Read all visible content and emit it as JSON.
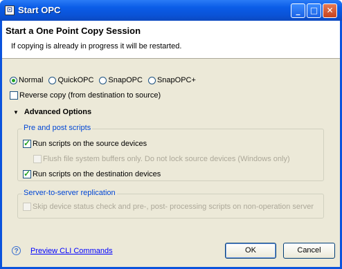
{
  "window": {
    "title": "Start OPC"
  },
  "header": {
    "title": "Start a One Point Copy Session",
    "subtitle": "If copying is already in progress it will be restarted."
  },
  "mode": {
    "options": [
      "Normal",
      "QuickOPC",
      "SnapOPC",
      "SnapOPC+"
    ],
    "selected": "Normal"
  },
  "reverse_copy": {
    "label": "Reverse copy (from destination to source)",
    "checked": false
  },
  "advanced": {
    "label": "Advanced Options",
    "pre_post": {
      "title": "Pre and post scripts",
      "run_source": {
        "label": "Run scripts on the source devices",
        "checked": true
      },
      "flush": {
        "label": "Flush file system buffers only. Do not lock source devices (Windows only)",
        "checked": false,
        "disabled": true
      },
      "run_dest": {
        "label": "Run scripts on the destination devices",
        "checked": true
      }
    },
    "server": {
      "title": "Server-to-server replication",
      "skip": {
        "label": "Skip device status check and pre-, post- processing scripts on non-operation server",
        "checked": false,
        "disabled": true
      }
    }
  },
  "footer": {
    "help_link": "Preview CLI Commands",
    "ok": "OK",
    "cancel": "Cancel"
  }
}
